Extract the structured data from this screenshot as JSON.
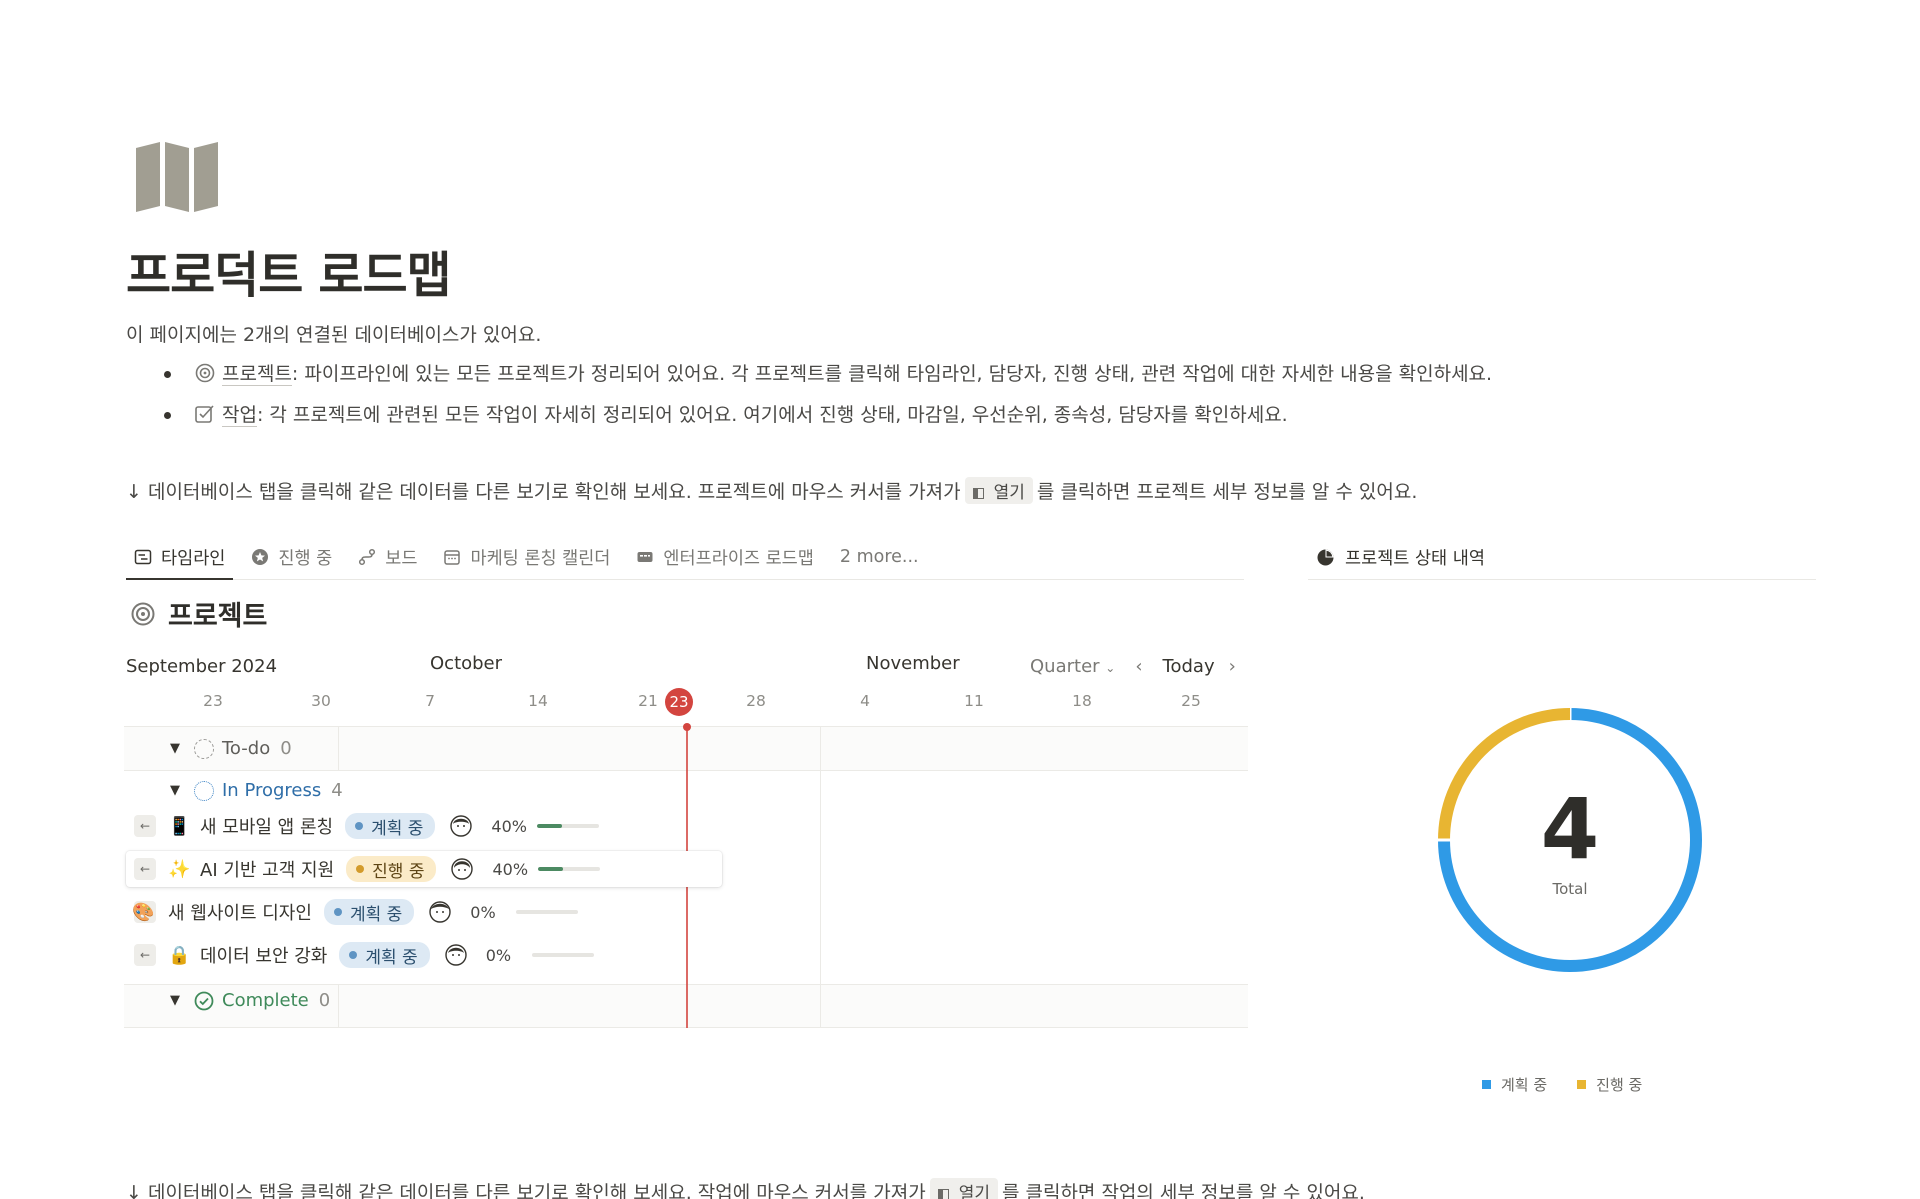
{
  "page": {
    "icon": "map-icon",
    "title": "프로덕트 로드맵",
    "intro": "이 페이지에는 2개의 연결된 데이터베이스가 있어요.",
    "bullets": [
      {
        "icon": "target-icon",
        "link": "프로젝트",
        "text": ": 파이프라인에 있는 모든 프로젝트가 정리되어 있어요. 각 프로젝트를 클릭해 타임라인, 담당자, 진행 상태, 관련 작업에 대한 자세한 내용을 확인하세요."
      },
      {
        "icon": "checkbox-edit-icon",
        "link": "작업",
        "text": ": 각 프로젝트에 관련된 모든 작업이 자세히 정리되어 있어요. 여기에서 진행 상태, 마감일, 우선순위, 종속성, 담당자를 확인하세요."
      }
    ],
    "hint1": {
      "before": "↓ 데이터베이스 탭을 클릭해 같은 데이터를 다른 보기로 확인해 보세요. 프로젝트에 마우스 커서를 가져가",
      "chip": "열기",
      "after": "를 클릭하면 프로젝트 세부 정보를 알 수 있어요."
    },
    "hint2": {
      "before": "↓ 데이터베이스 탭을 클릭해 같은 데이터를 다른 보기로 확인해 보세요. 작업에 마우스 커서를 가져가",
      "chip": "열기",
      "after": "를 클릭하면 작업의 세부 정보를 알 수 있어요."
    }
  },
  "tabs": [
    {
      "label": "타임라인",
      "icon": "timeline-icon",
      "active": true
    },
    {
      "label": "진행 중",
      "icon": "star-icon"
    },
    {
      "label": "보드",
      "icon": "board-icon"
    },
    {
      "label": "마케팅 론칭 캘린더",
      "icon": "calendar-icon"
    },
    {
      "label": "엔터프라이즈 로드맵",
      "icon": "enterprise-icon"
    },
    {
      "label": "2 more..."
    }
  ],
  "side_tab": {
    "label": "프로젝트 상태 내역",
    "icon": "pie-chart-icon"
  },
  "database": {
    "title": "프로젝트",
    "icon": "target-icon"
  },
  "timeline": {
    "months": [
      "September 2024",
      "October",
      "November"
    ],
    "view": "Quarter",
    "today_label": "Today",
    "days": [
      "23",
      "30",
      "7",
      "14",
      "21",
      "23",
      "28",
      "4",
      "11",
      "18",
      "25"
    ],
    "today_day": "23",
    "groups": [
      {
        "name": "To-do",
        "count": "0",
        "color": "#9b9a97"
      },
      {
        "name": "In Progress",
        "count": "4",
        "color": "#3b82c4"
      },
      {
        "name": "Complete",
        "count": "0",
        "color": "#3f8a5a"
      }
    ],
    "tasks": [
      {
        "emoji": "📱",
        "name": "새 모바일 앱 론칭",
        "status": "계획 중",
        "status_type": "planning",
        "progress_label": "40%",
        "progress": 0.4
      },
      {
        "emoji": "✨",
        "name": "AI 기반 고객 지원",
        "status": "진행 중",
        "status_type": "progress",
        "progress_label": "40%",
        "progress": 0.4
      },
      {
        "emoji": "🎨",
        "name": "새 웹사이트 디자인",
        "status": "계획 중",
        "status_type": "planning",
        "progress_label": "0%",
        "progress": 0
      },
      {
        "emoji": "🔒",
        "name": "데이터 보안 강화",
        "status": "계획 중",
        "status_type": "planning",
        "progress_label": "0%",
        "progress": 0
      }
    ]
  },
  "chart_data": {
    "type": "pie",
    "total": "4",
    "total_label": "Total",
    "categories": [
      "계획 중",
      "진행 중"
    ],
    "values": [
      3,
      1
    ],
    "colors": [
      "#2f9ae6",
      "#e8b532"
    ],
    "legend": "bottom"
  },
  "colors": {
    "accent_today": "#d3453f",
    "planning": "#2f9ae6",
    "in_progress": "#e8b532"
  }
}
